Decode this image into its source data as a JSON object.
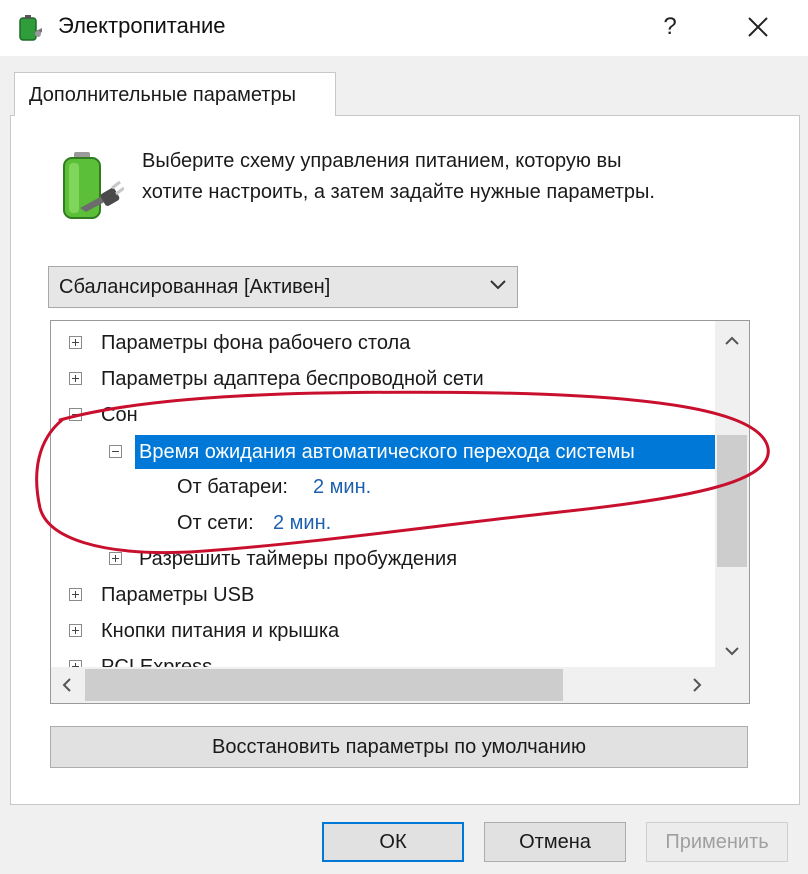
{
  "window": {
    "title": "Электропитание",
    "help_label": "?"
  },
  "tab": {
    "label": "Дополнительные параметры"
  },
  "intro": {
    "line1": "Выберите схему управления питанием, которую вы",
    "line2": "хотите настроить, а затем задайте нужные параметры."
  },
  "scheme_select": {
    "value": "Сбалансированная [Активен]"
  },
  "tree": {
    "items": [
      {
        "label": "Параметры фона рабочего стола",
        "expander": "plus"
      },
      {
        "label": "Параметры адаптера беспроводной сети",
        "expander": "plus"
      },
      {
        "label": "Сон",
        "expander": "minus"
      },
      {
        "label": "Время ожидания автоматического перехода системы",
        "expander": "minus",
        "selected": true
      },
      {
        "label": "От батареи:",
        "value": "2 мин."
      },
      {
        "label": "От сети:",
        "value": "2 мин."
      },
      {
        "label": "Разрешить таймеры пробуждения",
        "expander": "plus"
      },
      {
        "label": "Параметры USB",
        "expander": "plus"
      },
      {
        "label": "Кнопки питания и крышка",
        "expander": "plus"
      },
      {
        "label": "PCI Express",
        "expander": "plus"
      }
    ]
  },
  "buttons": {
    "restore": "Восстановить параметры по умолчанию",
    "ok": "ОК",
    "cancel": "Отмена",
    "apply": "Применить"
  },
  "colors": {
    "selection": "#0078d7",
    "value_text": "#1e60b0",
    "annotation": "#c8102e"
  }
}
